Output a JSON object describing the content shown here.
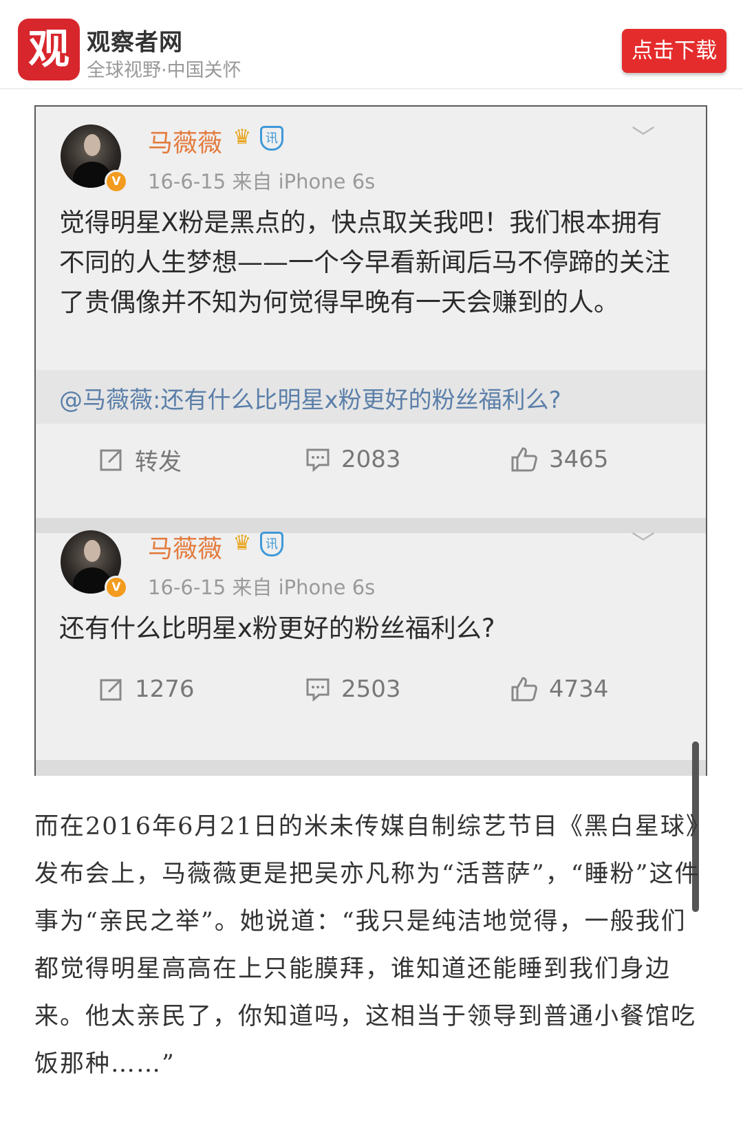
{
  "header": {
    "logo_char": "观",
    "brand": "观察者网",
    "slogan": "全球视野·中国关怀",
    "download_button": "点击下载",
    "brand_color": "#d8262d"
  },
  "posts": [
    {
      "user": "马薇薇",
      "verified_badge": "V",
      "badge_icons": [
        "crown-icon",
        "shield-icon"
      ],
      "shield_label": "讯",
      "meta": "16-6-15  来自 iPhone 6s",
      "text": "觉得明星X粉是黑点的，快点取关我吧！我们根本拥有不同的人生梦想——一个今早看新闻后马不停蹄的关注了贵偶像并不知为何觉得早晚有一天会赚到的人。",
      "quote": "@马薇薇:还有什么比明星x粉更好的粉丝福利么?",
      "repost": "转发",
      "comments": "2083",
      "likes": "3465"
    },
    {
      "user": "马薇薇",
      "verified_badge": "V",
      "badge_icons": [
        "crown-icon",
        "shield-icon"
      ],
      "shield_label": "讯",
      "meta": "16-6-15  来自 iPhone 6s",
      "text": "还有什么比明星x粉更好的粉丝福利么?",
      "repost": "1276",
      "comments": "2503",
      "likes": "4734"
    }
  ],
  "article": {
    "paragraph": "而在2016年6月21日的米未传媒自制综艺节目《黑白星球》发布会上，马薇薇更是把吴亦凡称为“活菩萨”，“睡粉”这件事为“亲民之举”。她说道：“我只是纯洁地觉得，一般我们都觉得明星高高在上只能膜拜，谁知道还能睡到我们身边来。他太亲民了，你知道吗，这相当于领导到普通小餐馆吃饭那种……”"
  },
  "colors": {
    "username": "#e37b3e",
    "quote_link": "#5b7fa9",
    "download_button": "#e52c2c"
  }
}
